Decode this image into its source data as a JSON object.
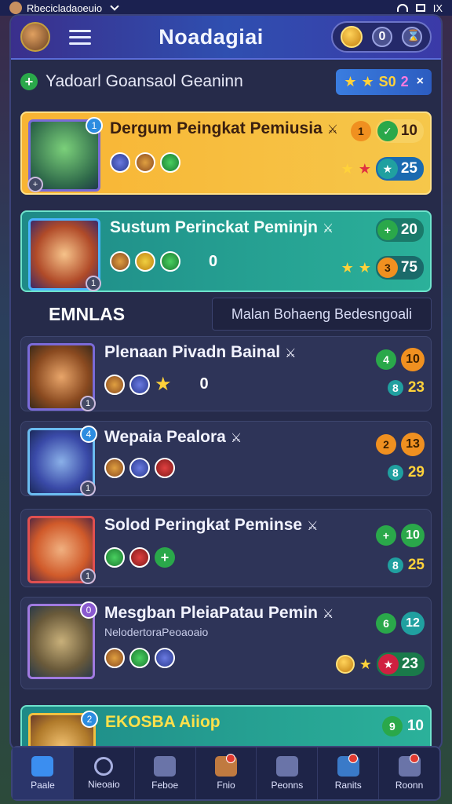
{
  "status": {
    "app_label": "Rbecicladaoeuio",
    "right_label": "IX"
  },
  "header": {
    "title": "Noadagiai",
    "pill_value": "0"
  },
  "subbar": {
    "text": "Yadoarl Goansaol Geaninn",
    "reward_value": "S0",
    "reward_extra": "2",
    "close": "×"
  },
  "section": {
    "title": "EMNLAS",
    "filter_label": "Malan Bohaeng Bedesngoali"
  },
  "cards": [
    {
      "name": "Dergum Peingkat Pemiusia",
      "sub": "",
      "count": "",
      "stat1_icon": "1",
      "stat1_value": "10",
      "stat2_icon": "★",
      "stat2_value": "25"
    },
    {
      "name": "Sustum Perinckat Peminjn",
      "sub": "",
      "count": "0",
      "stat1_icon": "+",
      "stat1_value": "20",
      "stat2_icon": "3",
      "stat2_value": "75"
    },
    {
      "name": "Plenaan Pivadn Bainal",
      "sub": "",
      "count": "0",
      "stat1_icon": "4",
      "stat1_value": "10",
      "stat2_icon": "8",
      "stat2_value": "23"
    },
    {
      "name": "Wepaia Pealora",
      "sub": "",
      "count": "",
      "stat1_icon": "2",
      "stat1_value": "13",
      "stat2_icon": "8",
      "stat2_value": "29"
    },
    {
      "name": "Solod Peringkat Peminse",
      "sub": "",
      "count": "",
      "stat1_icon": "+",
      "stat1_value": "10",
      "stat2_icon": "8",
      "stat2_value": "25"
    },
    {
      "name": "Mesgban PleiaPatau Pemin",
      "sub": "NelodertoraPeoaoaio",
      "count": "",
      "stat1_icon": "6",
      "stat1_value": "12",
      "stat2_icon": "★",
      "stat2_value": "23"
    },
    {
      "name": "EKOSBA Aiiop",
      "sub": "",
      "count": "",
      "stat1_icon": "9",
      "stat1_value": "10",
      "stat2_icon": "",
      "stat2_value": ""
    }
  ],
  "nav": [
    {
      "label": "Paale",
      "icon": "home-icon",
      "active": true
    },
    {
      "label": "Nieoaio",
      "icon": "search-icon"
    },
    {
      "label": "Feboe",
      "icon": "inventory-icon"
    },
    {
      "label": "Fnio",
      "icon": "battle-icon"
    },
    {
      "label": "Peonns",
      "icon": "mail-icon"
    },
    {
      "label": "Ranits",
      "icon": "rank-icon"
    },
    {
      "label": "Roonn",
      "icon": "profile-icon"
    }
  ]
}
